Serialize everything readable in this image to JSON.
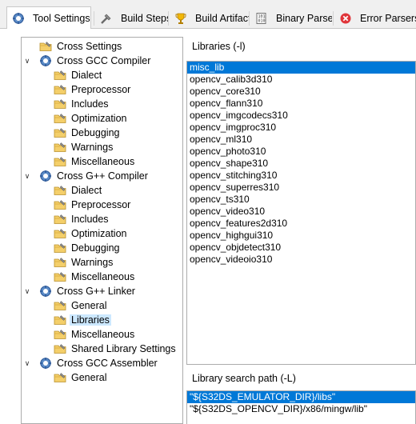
{
  "tabs": [
    {
      "label": "Tool Settings",
      "icon": "gear-icon",
      "active": true
    },
    {
      "label": "Build Steps",
      "icon": "build-steps-icon",
      "active": false
    },
    {
      "label": "Build Artifact",
      "icon": "trophy-icon",
      "active": false
    },
    {
      "label": "Binary Parsers",
      "icon": "binary-parser-icon",
      "active": false
    },
    {
      "label": "Error Parsers",
      "icon": "error-icon",
      "active": false
    }
  ],
  "tree": {
    "cross_settings": "Cross Settings",
    "gcc_compiler": {
      "label": "Cross GCC Compiler",
      "children": [
        "Dialect",
        "Preprocessor",
        "Includes",
        "Optimization",
        "Debugging",
        "Warnings",
        "Miscellaneous"
      ]
    },
    "gpp_compiler": {
      "label": "Cross G++ Compiler",
      "children": [
        "Dialect",
        "Preprocessor",
        "Includes",
        "Optimization",
        "Debugging",
        "Warnings",
        "Miscellaneous"
      ]
    },
    "gpp_linker": {
      "label": "Cross G++ Linker",
      "children": [
        "General",
        "Libraries",
        "Miscellaneous",
        "Shared Library Settings"
      ]
    },
    "gcc_assembler": {
      "label": "Cross GCC Assembler",
      "children": [
        "General"
      ]
    },
    "selected": "Libraries"
  },
  "libraries": {
    "title": "Libraries (-l)",
    "items": [
      "misc_lib",
      "opencv_calib3d310",
      "opencv_core310",
      "opencv_flann310",
      "opencv_imgcodecs310",
      "opencv_imgproc310",
      "opencv_ml310",
      "opencv_photo310",
      "opencv_shape310",
      "opencv_stitching310",
      "opencv_superres310",
      "opencv_ts310",
      "opencv_video310",
      "opencv_features2d310",
      "opencv_highgui310",
      "opencv_objdetect310",
      "opencv_videoio310"
    ],
    "selected_index": 0
  },
  "search_path": {
    "title": "Library search path (-L)",
    "items": [
      "\"${S32DS_EMULATOR_DIR}/libs\"",
      "\"${S32DS_OPENCV_DIR}/x86/mingw/lib\""
    ],
    "selected_index": 0
  }
}
